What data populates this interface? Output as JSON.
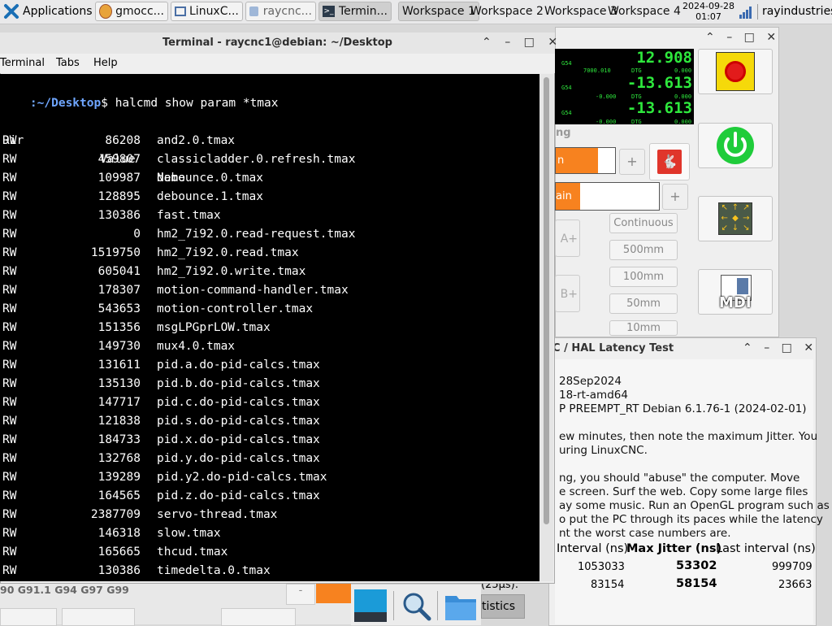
{
  "panel": {
    "apps_label": "Applications",
    "tasks": [
      "gmocc...",
      "LinuxC...",
      "raycnc...",
      "Termin..."
    ],
    "workspaces": [
      "Workspace 1",
      "Workspace 2",
      "Workspace 3",
      "Workspace 4"
    ],
    "date": "2024-09-28",
    "time": "01:07",
    "user": "rayindustries"
  },
  "terminal": {
    "title": "Terminal - raycnc1@debian: ~/Desktop",
    "menu": [
      "Terminal",
      "Tabs",
      "Help"
    ],
    "prompt_prefix": ":~/Desktop",
    "prompt_symbol": "$",
    "command": "halcmd show param *tmax",
    "header": {
      "dir": "Dir",
      "value": "Value",
      "name": "Name"
    },
    "rows": [
      {
        "dir": "RW",
        "value": "86208",
        "name": "and2.0.tmax"
      },
      {
        "dir": "RW",
        "value": "459807",
        "name": "classicladder.0.refresh.tmax"
      },
      {
        "dir": "RW",
        "value": "109987",
        "name": "debounce.0.tmax"
      },
      {
        "dir": "RW",
        "value": "128895",
        "name": "debounce.1.tmax"
      },
      {
        "dir": "RW",
        "value": "130386",
        "name": "fast.tmax"
      },
      {
        "dir": "RW",
        "value": "0",
        "name": "hm2_7i92.0.read-request.tmax"
      },
      {
        "dir": "RW",
        "value": "1519750",
        "name": "hm2_7i92.0.read.tmax"
      },
      {
        "dir": "RW",
        "value": "605041",
        "name": "hm2_7i92.0.write.tmax"
      },
      {
        "dir": "RW",
        "value": "178307",
        "name": "motion-command-handler.tmax"
      },
      {
        "dir": "RW",
        "value": "543653",
        "name": "motion-controller.tmax"
      },
      {
        "dir": "RW",
        "value": "151356",
        "name": "msgLPGprLOW.tmax"
      },
      {
        "dir": "RW",
        "value": "149730",
        "name": "mux4.0.tmax"
      },
      {
        "dir": "RW",
        "value": "131611",
        "name": "pid.a.do-pid-calcs.tmax"
      },
      {
        "dir": "RW",
        "value": "135130",
        "name": "pid.b.do-pid-calcs.tmax"
      },
      {
        "dir": "RW",
        "value": "147717",
        "name": "pid.c.do-pid-calcs.tmax"
      },
      {
        "dir": "RW",
        "value": "121838",
        "name": "pid.s.do-pid-calcs.tmax"
      },
      {
        "dir": "RW",
        "value": "184733",
        "name": "pid.x.do-pid-calcs.tmax"
      },
      {
        "dir": "RW",
        "value": "132768",
        "name": "pid.y.do-pid-calcs.tmax"
      },
      {
        "dir": "RW",
        "value": "139289",
        "name": "pid.y2.do-pid-calcs.tmax"
      },
      {
        "dir": "RW",
        "value": "164565",
        "name": "pid.z.do-pid-calcs.tmax"
      },
      {
        "dir": "RW",
        "value": "2387709",
        "name": "servo-thread.tmax"
      },
      {
        "dir": "RW",
        "value": "146318",
        "name": "slow.tmax"
      },
      {
        "dir": "RW",
        "value": "165665",
        "name": "thcud.tmax"
      },
      {
        "dir": "RW",
        "value": "130386",
        "name": "timedelta.0.tmax"
      }
    ]
  },
  "cnc": {
    "dro": [
      {
        "g": "G54",
        "small": "7000.010",
        "dtg": "DTG",
        "dtg_val": "0.000",
        "big": "12.908"
      },
      {
        "g": "G54",
        "small": "-0.000",
        "dtg": "DTG",
        "dtg_val": "0.000",
        "big": "-13.613"
      },
      {
        "g": "G54",
        "small": "-0.000",
        "dtg": "DTG",
        "dtg_val": "0.000",
        "big": "-13.613"
      }
    ],
    "section_label": "ng",
    "slider1_label": "n",
    "slider2_label": "ain",
    "plus": "+",
    "axis_a": "A+",
    "axis_b": "B+",
    "continuous": "Continuous",
    "distances": [
      "500mm",
      "100mm",
      "50mm",
      "10mm"
    ],
    "mdi_label": "MDI",
    "gcodes": "90 G91.1 G94 G97 G99",
    "latency_sub": "(25µs):",
    "statistics": "tistics"
  },
  "latency": {
    "title": "C / HAL Latency Test",
    "lines": [
      "28Sep2024",
      "18-rt-amd64",
      "P PREEMPT_RT Debian 6.1.76-1 (2024-02-01)",
      "ew minutes, then note the maximum Jitter. You",
      "uring LinuxCNC.",
      "ng, you should \"abuse\" the computer. Move",
      "e screen. Surf the web. Copy some large files",
      "ay some music. Run an OpenGL program such as",
      "o put the PC through its paces while the latency",
      "nt the worst case numbers are."
    ],
    "headers": [
      "Interval (ns)",
      "Max Jitter (ns)",
      "Last interval (ns)"
    ],
    "rows": [
      [
        "1053033",
        "53302",
        "999709"
      ],
      [
        "83154",
        "58154",
        "23663"
      ]
    ]
  }
}
